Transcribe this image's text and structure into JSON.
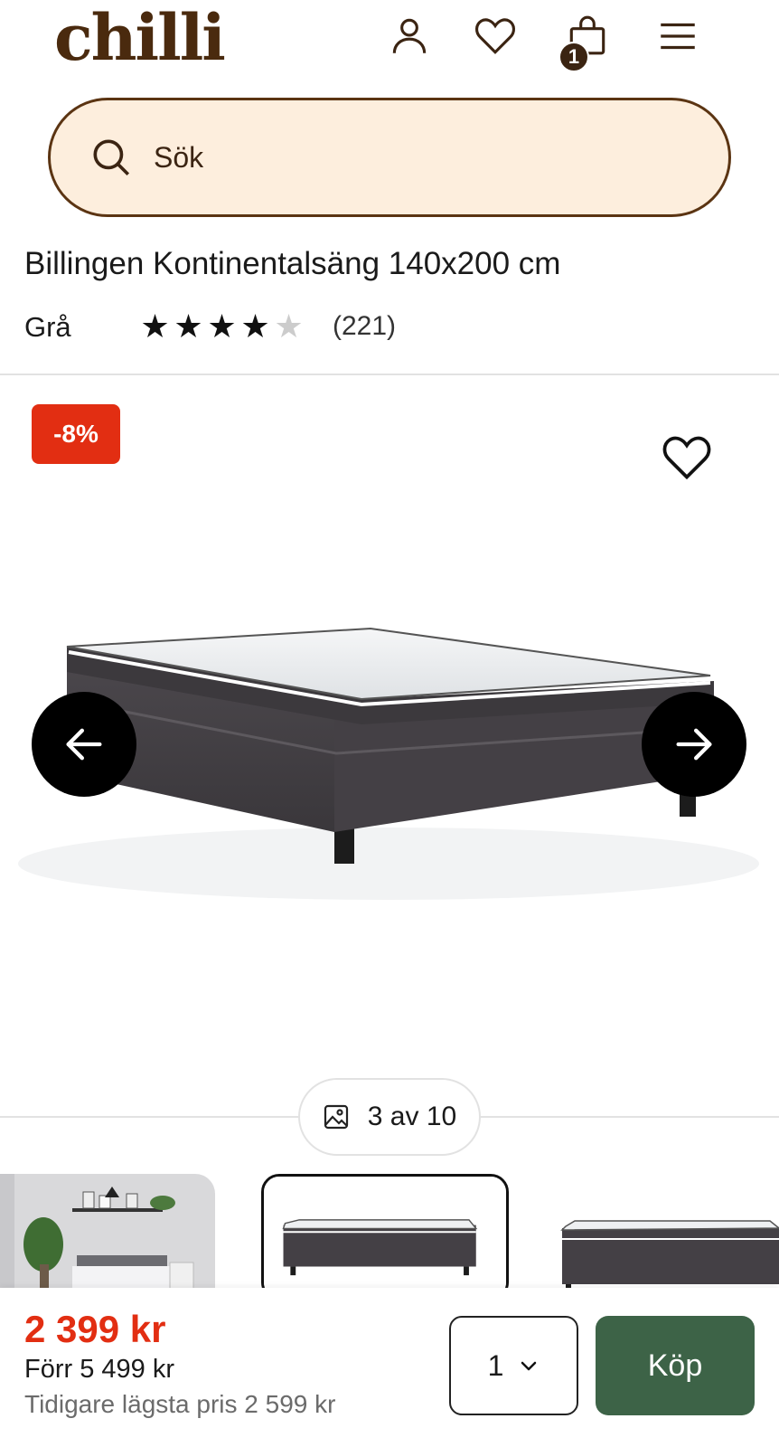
{
  "header": {
    "logo": "chilli",
    "icons": [
      "user-icon",
      "heart-icon",
      "cart-icon",
      "menu-icon"
    ],
    "cart_count": "1"
  },
  "search": {
    "placeholder": "Sök"
  },
  "product": {
    "title": "Billingen Kontinentalsäng 140x200 cm",
    "color": "Grå",
    "rating": 4,
    "rating_max": 5,
    "reviews": "(221)"
  },
  "gallery": {
    "discount": "-8%",
    "counter": "3 av 10",
    "current": 3,
    "total": 10
  },
  "purchase": {
    "price": "2 399 kr",
    "before": "Förr 5 499 kr",
    "lowest": "Tidigare lägsta pris 2 599 kr",
    "quantity": "1",
    "buy_label": "Köp"
  },
  "colors": {
    "brand_brown": "#4a2a0e",
    "search_bg": "#fdeedd",
    "sale_red": "#e22e12",
    "buy_green": "#3d6347"
  }
}
